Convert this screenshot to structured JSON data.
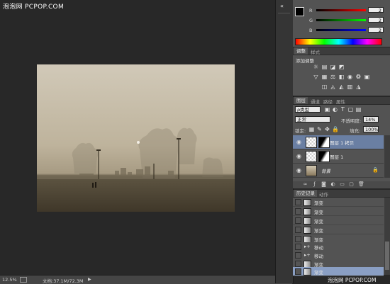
{
  "watermark": {
    "text": "泡泡网 PCPOP.COM"
  },
  "status_bar": {
    "zoom": "12.5%",
    "doc_info": "文档:37.1M/72.3M"
  },
  "color_panel": {
    "channels": [
      {
        "label": "R",
        "value": "2",
        "color": "#d92f2f"
      },
      {
        "label": "G",
        "value": "2",
        "color": "#2faf2f"
      },
      {
        "label": "B",
        "value": "2",
        "color": "#2f4fd9"
      }
    ]
  },
  "adjust_panel": {
    "tabs": [
      "调整",
      "样式"
    ],
    "title": "添加调整",
    "row1_icons": [
      "brightness-icon",
      "levels-icon",
      "curves-icon",
      "exposure-icon"
    ],
    "row2_icons": [
      "vibrance-icon",
      "hue-sat-icon",
      "color-balance-icon",
      "bw-icon",
      "photo-filter-icon",
      "channel-mixer-icon"
    ],
    "row3_icons": [
      "invert-icon",
      "posterize-icon",
      "threshold-icon",
      "gradient-map-icon",
      "selective-color-icon"
    ]
  },
  "layers_panel": {
    "tabs": [
      "图层",
      "通道",
      "路径",
      "属性"
    ],
    "filter_kind": "ρ类型",
    "blend_mode": "正常",
    "opacity_label": "不透明度:",
    "opacity_value": "14%",
    "lock_label": "锁定:",
    "fill_label": "填充:",
    "fill_value": "100%",
    "layers": [
      {
        "name": "图层 1 拷贝",
        "selected": true
      },
      {
        "name": "图层 1",
        "selected": false
      },
      {
        "name": "背景",
        "selected": false
      }
    ]
  },
  "history_panel": {
    "tabs": [
      "历史记录",
      "动作"
    ],
    "items": [
      "渐变",
      "渐变",
      "渐变",
      "渐变",
      "渐变",
      "渐变",
      "移动",
      "移动",
      "渐变",
      "渐变"
    ],
    "footer": "泡泡网 PCPOP.COM"
  }
}
